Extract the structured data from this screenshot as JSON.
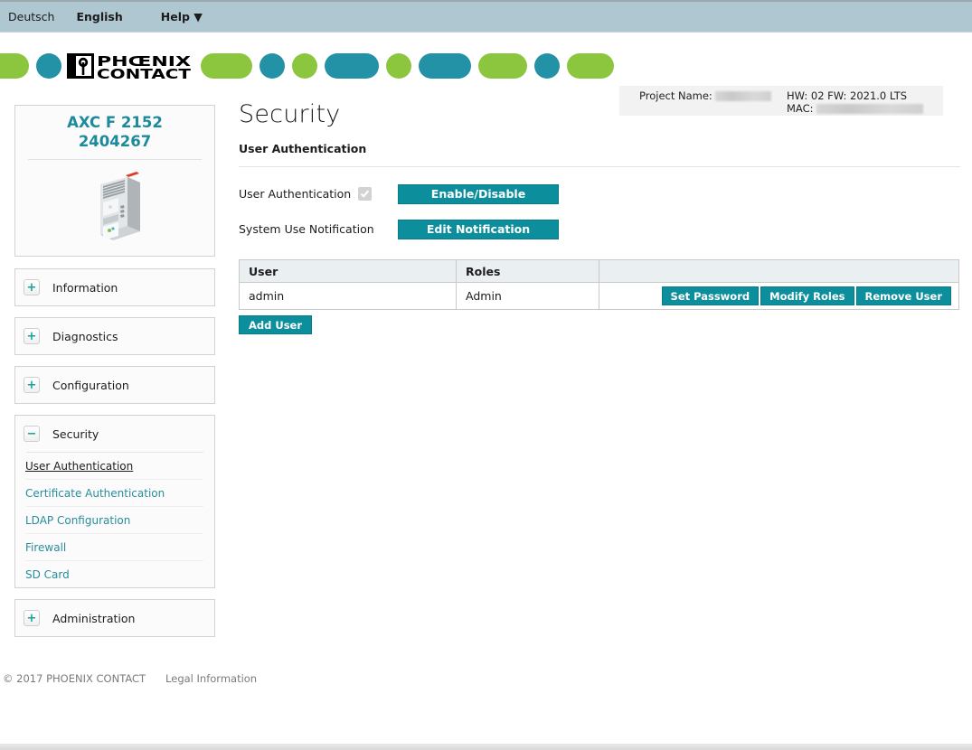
{
  "topbar": {
    "lang_de": "Deutsch",
    "lang_en": "English",
    "help": "Help ▼"
  },
  "header": {
    "brand_line1": "PHŒNIX",
    "brand_line2": "CONTACT",
    "project_name_label": "Project Name:",
    "project_name_value": "",
    "hw_fw": "HW: 02 FW: 2021.0 LTS",
    "mac_label": "MAC:",
    "mac_value": ""
  },
  "colors": {
    "accent_teal": "#0d8e9c",
    "logo_green": "#8cc63e",
    "logo_teal": "#2392a6",
    "topbar_blue": "#afc7d1",
    "device_title": "#1b8a9b",
    "link_teal": "#2a8d9c",
    "toggle_icon": "#16a39b"
  },
  "sidebar": {
    "device": {
      "model": "AXC F 2152",
      "order_number": "2404267",
      "image_icon": "plc-controller-image"
    },
    "panels": [
      {
        "label": "Information",
        "state": "collapsed",
        "toggle": "+"
      },
      {
        "label": "Diagnostics",
        "state": "collapsed",
        "toggle": "+"
      },
      {
        "label": "Configuration",
        "state": "collapsed",
        "toggle": "+"
      },
      {
        "label": "Security",
        "state": "expanded",
        "toggle": "−"
      },
      {
        "label": "Administration",
        "state": "collapsed",
        "toggle": "+"
      }
    ],
    "security_items": [
      {
        "label": "User Authentication",
        "active": true
      },
      {
        "label": "Certificate Authentication",
        "active": false
      },
      {
        "label": "LDAP Configuration",
        "active": false
      },
      {
        "label": "Firewall",
        "active": false
      },
      {
        "label": "SD Card",
        "active": false
      }
    ]
  },
  "main": {
    "page_title": "Security",
    "section_title": "User Authentication",
    "rows": [
      {
        "label": "User Authentication",
        "has_checkbox": true,
        "checkbox_checked": true,
        "checkbox_disabled": true,
        "button": "Enable/Disable"
      },
      {
        "label": "System Use Notification",
        "has_checkbox": false,
        "button": "Edit Notification"
      }
    ],
    "table": {
      "headers": [
        "User",
        "Roles",
        ""
      ],
      "rows": [
        {
          "user": "admin",
          "roles": "Admin",
          "actions": [
            "Set Password",
            "Modify Roles",
            "Remove User"
          ]
        }
      ]
    },
    "add_user_button": "Add User"
  },
  "footer": {
    "copyright": "© 2017 PHOENIX CONTACT",
    "legal": "Legal Information"
  }
}
